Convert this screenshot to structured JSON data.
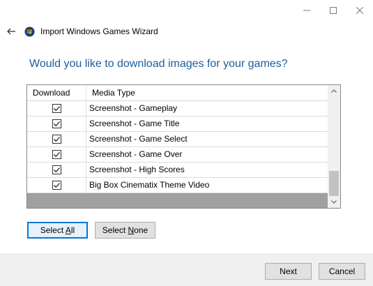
{
  "window": {
    "title": "Import Windows Games Wizard",
    "controls": [
      "minimize-icon",
      "maximize-icon",
      "close-icon"
    ]
  },
  "page": {
    "heading": "Would you like to download images for your games?"
  },
  "grid": {
    "columns": [
      "Download",
      "Media Type"
    ],
    "rows": [
      {
        "checked": true,
        "media_type": "Screenshot - Gameplay"
      },
      {
        "checked": true,
        "media_type": "Screenshot - Game Title"
      },
      {
        "checked": true,
        "media_type": "Screenshot - Game Select"
      },
      {
        "checked": true,
        "media_type": "Screenshot - Game Over"
      },
      {
        "checked": true,
        "media_type": "Screenshot - High Scores"
      },
      {
        "checked": true,
        "media_type": "Big Box Cinematix Theme Video"
      }
    ],
    "scroll_position": 1.0
  },
  "buttons": {
    "select_all_prefix": "Select ",
    "select_all_mnemonic": "A",
    "select_all_suffix": "ll",
    "select_none_prefix": "Select ",
    "select_none_mnemonic": "N",
    "select_none_suffix": "one",
    "next": "Next",
    "cancel": "Cancel"
  },
  "colors": {
    "heading": "#1e5b9c",
    "focus_border": "#0078d7",
    "footer_bg": "#f0f0f0"
  }
}
